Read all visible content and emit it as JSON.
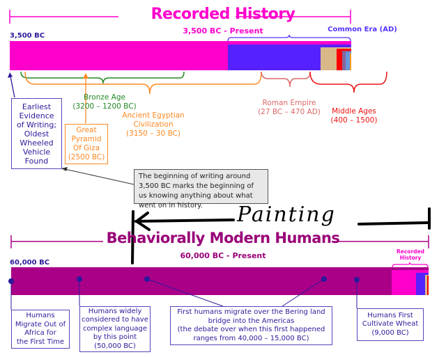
{
  "recorded_history": {
    "title": "Recorded History",
    "subtitle": "3,500 BC - Present",
    "start_label": "3,500 BC",
    "common_era_label": "Common Era (AD)",
    "colors": {
      "bar": "#ff00cc",
      "common_era": "#5522ff",
      "segment_tan": "#d8b888",
      "segment_red": "#ff0000",
      "segment_mauve": "#886699",
      "segment_blue": "#6699dd",
      "segment_orange": "#ff9922"
    },
    "spans": [
      {
        "name": "bronze-age",
        "label": "Bronze Age",
        "range": "(3200 – 1200 BC)",
        "color": "#228822"
      },
      {
        "name": "ancient-egypt",
        "label": "Ancient Egyptian Civilization",
        "range": "(3150 – 30 BC)",
        "color": "#ff8822"
      },
      {
        "name": "roman-empire",
        "label": "Roman Empire",
        "range": "(27 BC – 470 AD)",
        "color": "#dd5555"
      },
      {
        "name": "middle-ages",
        "label": "Middle Ages",
        "range": "(400 – 1500)",
        "color": "#ee1111"
      }
    ],
    "events": {
      "writing": {
        "line1": "Earliest",
        "line2": "Evidence",
        "line3": "of Writing;",
        "line4": "Oldest",
        "line5": "Wheeled",
        "line6": "Vehicle",
        "line7": "Found",
        "color": "#2a1a9a"
      },
      "pyramid": {
        "line1": "Great",
        "line2": "Pyramid",
        "line3": "Of Giza",
        "line4": "(2500 BC)",
        "color": "#ff8822"
      }
    },
    "note": "The beginning of writing around 3,500 BC marks the beginning of us knowing anything about what went on in history."
  },
  "annotation": {
    "text": "Painting"
  },
  "modern_humans": {
    "title": "Behaviorally Modern Humans",
    "subtitle": "60,000 BC - Present",
    "start_label": "60,000 BC",
    "recorded_history_label_1": "Recorded",
    "recorded_history_label_2": "History",
    "colors": {
      "bar": "#aa0088",
      "recorded": "#ff00cc",
      "marker": "#2a1a9a"
    },
    "events": [
      {
        "name": "out-of-africa",
        "lines": [
          "Humans",
          "Migrate Out of",
          "Africa for",
          "the First Time"
        ]
      },
      {
        "name": "complex-language",
        "lines": [
          "Humans widely",
          "considered to have",
          "complex language",
          "by this point",
          "(50,000 BC)"
        ]
      },
      {
        "name": "bering-migration",
        "lines": [
          "First humans migrate over the Bering land",
          "bridge into the Americas",
          "(the debate over when this first happened",
          "ranges from 40,000 – 15,000 BC)"
        ]
      },
      {
        "name": "cultivate-wheat",
        "lines": [
          "Humans First",
          "Cultivate Wheat",
          "(9,000 BC)"
        ]
      }
    ]
  }
}
